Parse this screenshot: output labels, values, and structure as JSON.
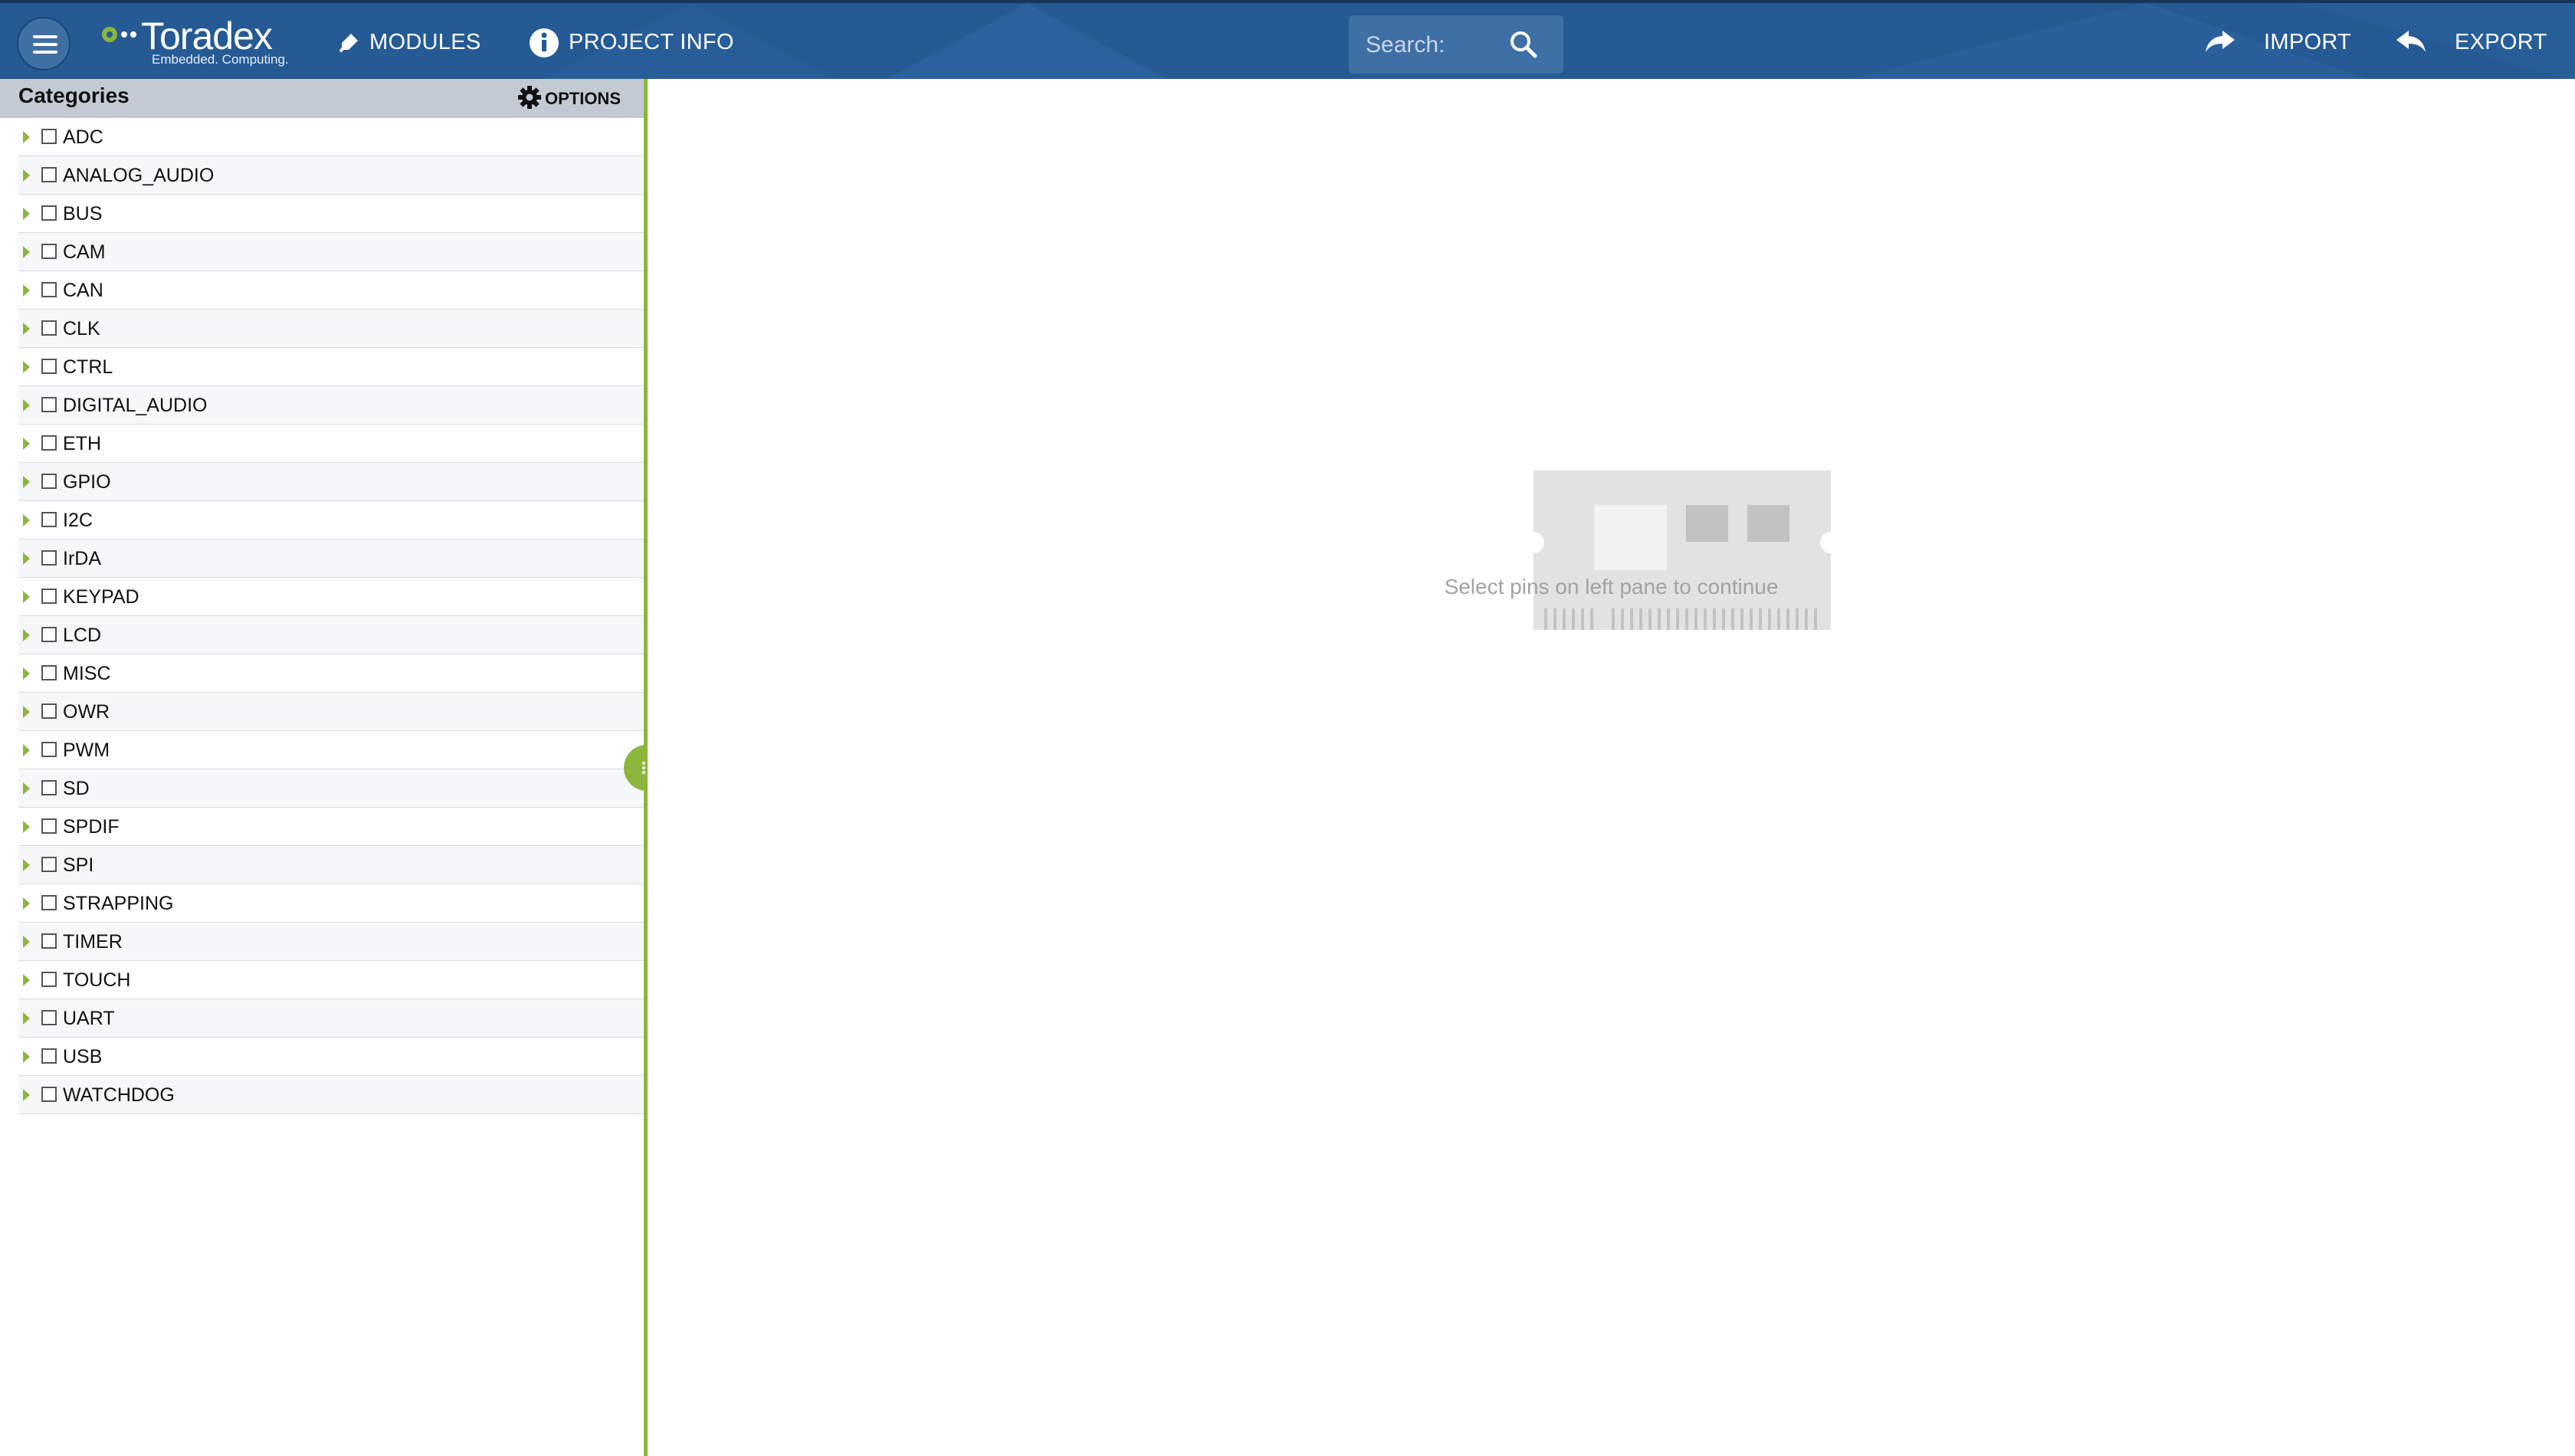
{
  "header": {
    "brand": "Toradex",
    "tagline": "Embedded. Computing.",
    "nav": {
      "modules": "MODULES",
      "project_info": "PROJECT INFO",
      "import": "IMPORT",
      "export": "EXPORT"
    },
    "search": {
      "placeholder": "Search:",
      "value": ""
    },
    "icons": {
      "menu": "hamburger-menu-icon",
      "modules": "pin-icon",
      "project_info": "info-icon",
      "search": "search-icon",
      "import": "import-arrow-icon",
      "export": "export-arrow-icon"
    },
    "colors": {
      "bar": "#255a94",
      "accent": "#8cb63c"
    }
  },
  "sidebar": {
    "title": "Categories",
    "options_label": "OPTIONS",
    "categories": [
      "ADC",
      "ANALOG_AUDIO",
      "BUS",
      "CAM",
      "CAN",
      "CLK",
      "CTRL",
      "DIGITAL_AUDIO",
      "ETH",
      "GPIO",
      "I2C",
      "IrDA",
      "KEYPAD",
      "LCD",
      "MISC",
      "OWR",
      "PWM",
      "SD",
      "SPDIF",
      "SPI",
      "STRAPPING",
      "TIMER",
      "TOUCH",
      "UART",
      "USB",
      "WATCHDOG"
    ]
  },
  "main": {
    "empty_message": "Select pins on left pane to continue"
  }
}
